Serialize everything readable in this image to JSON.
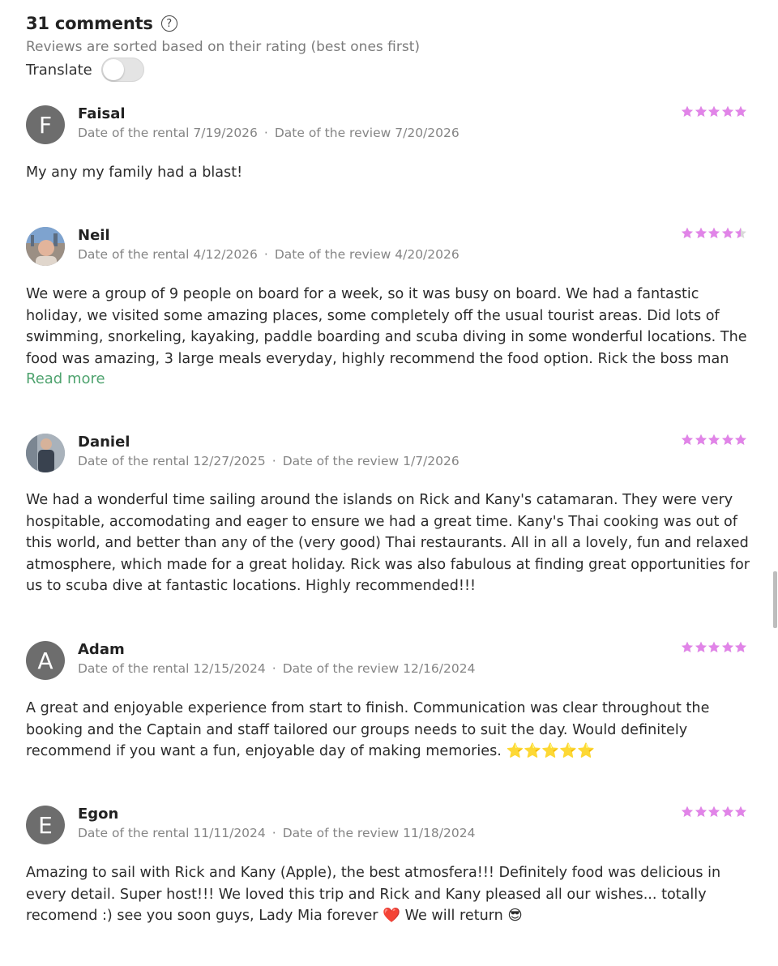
{
  "header": {
    "title": "31 comments",
    "help_icon": "question-circle-icon",
    "subtitle": "Reviews are sorted based on their rating (best ones first)",
    "translate_label": "Translate",
    "translate_on": false
  },
  "labels": {
    "rental_prefix": "Date of the rental",
    "review_prefix": "Date of the review",
    "separator": "·"
  },
  "colors": {
    "star": "#e184e8",
    "star_empty": "#d9d9d9",
    "link": "#4fa36f",
    "avatar_bg": "#6d6d6d"
  },
  "reviews": [
    {
      "name": "Faisal",
      "avatar_letter": "F",
      "rental_date": "7/19/2026",
      "review_date": "7/20/2026",
      "rating": 5,
      "text": "My any my family had a blast!"
    },
    {
      "name": "Neil",
      "avatar_letter": "",
      "avatar_icon": "user-photo",
      "rental_date": "4/12/2026",
      "review_date": "4/20/2026",
      "rating": 4.5,
      "text": "We were a group of 9 people on board for a week, so it was busy on board. We had a fantastic holiday, we visited some amazing places, some completely off the usual tourist areas. Did lots of swimming, snorkeling, kayaking, paddle boarding and scuba diving in some wonderful locations. The food was amazing, 3 large meals everyday, highly recommend the food option. Rick the boss man",
      "read_more": "Read more"
    },
    {
      "name": "Daniel",
      "avatar_letter": "",
      "avatar_icon": "user-photo",
      "rental_date": "12/27/2025",
      "review_date": "1/7/2026",
      "rating": 5,
      "text": "We had a wonderful time sailing around the islands on Rick and Kany's catamaran. They were very hospitable, accomodating and eager to ensure we had a great time. Kany's Thai cooking was out of this world, and better than any of the (very good) Thai restaurants. All in all a lovely, fun and relaxed atmosphere, which made for a great holiday. Rick was also fabulous at finding great opportunities for us to scuba dive at fantastic locations. Highly recommended!!!"
    },
    {
      "name": "Adam",
      "avatar_letter": "A",
      "rental_date": "12/15/2024",
      "review_date": "12/16/2024",
      "rating": 5,
      "text": "A great and enjoyable experience from start to finish. Communication was clear throughout the booking and the Captain and staff tailored our groups needs to suit the day. Would definitely recommend if you want a fun, enjoyable day of making memories. ⭐⭐⭐⭐⭐"
    },
    {
      "name": "Egon",
      "avatar_letter": "E",
      "rental_date": "11/11/2024",
      "review_date": "11/18/2024",
      "rating": 5,
      "text": "Amazing to sail with Rick and Kany (Apple), the best atmosfera!!! Definitely food was delicious in every detail. Super host!!! We loved this trip and Rick and Kany pleased all our wishes... totally recomend :) see you soon guys, Lady Mia forever ❤️ We will return 😎"
    }
  ]
}
